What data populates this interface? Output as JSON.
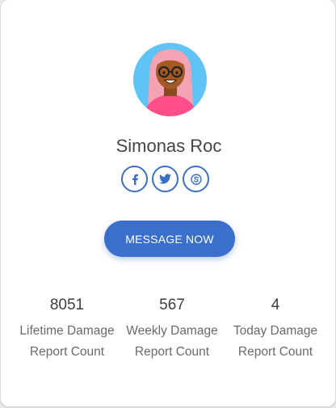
{
  "profile": {
    "name": "Simonas Roc",
    "avatar": "avatar-illustration"
  },
  "socials": [
    {
      "icon": "facebook-icon"
    },
    {
      "icon": "twitter-icon"
    },
    {
      "icon": "skype-icon"
    }
  ],
  "actions": {
    "message_label": "MESSAGE NOW"
  },
  "stats": [
    {
      "value": "8051",
      "label": "Lifetime Damage Report Count"
    },
    {
      "value": "567",
      "label": "Weekly Damage Report Count"
    },
    {
      "value": "4",
      "label": "Today Damage Report Count"
    }
  ],
  "colors": {
    "accent": "#3a6fcb",
    "name_text": "#454545",
    "label_text": "#6a6a6a"
  }
}
